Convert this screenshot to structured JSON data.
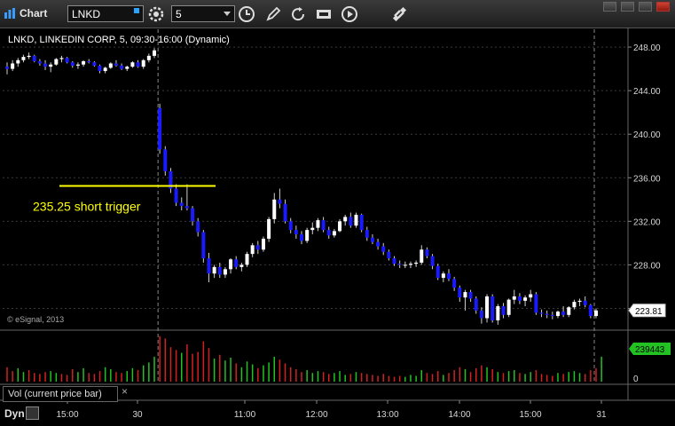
{
  "window": {
    "title": "Chart",
    "symbol_value": "LNKD",
    "interval_value": "5"
  },
  "icons": [
    "chart-icon",
    "settings-icon",
    "clock-icon",
    "pencil-icon",
    "refresh-icon",
    "go-icon",
    "play-icon",
    "link-icon",
    "minimize-icon",
    "maximize-icon",
    "close-icon"
  ],
  "chart_header": "LNKD, LINKEDIN CORP, 5, 09:30-16:00 (Dynamic)",
  "copyright": "© eSignal, 2013",
  "volume_panel_label": "Vol (current price bar)",
  "volume_close_glyph": "×",
  "dyn_label": "Dyn",
  "chart_data": {
    "type": "candlestick",
    "y_ticks": [
      "248.00",
      "244.00",
      "240.00",
      "236.00",
      "232.00",
      "228.00",
      "224.00"
    ],
    "ylim": [
      222.0,
      249.8
    ],
    "x_ticks": [
      "15:00",
      "30",
      "11:00",
      "12:00",
      "13:00",
      "14:00",
      "15:00",
      "31"
    ],
    "last_price_label": "223.81",
    "volume_label": "239443",
    "volume_zero_label": "0",
    "annotation": {
      "text": "235.25 short trigger",
      "level": 235.25,
      "color": "#ffff00"
    },
    "colors": {
      "up": "#ffffff",
      "down": "#1a1aff",
      "vol_up": "#22c222",
      "vol_down": "#d42020",
      "grid": "#3a3a3a"
    },
    "candles": [
      [
        246.2,
        246.6,
        245.5,
        246.0
      ],
      [
        246.0,
        246.8,
        245.8,
        246.5
      ],
      [
        246.5,
        247.0,
        246.2,
        246.8
      ],
      [
        246.8,
        247.3,
        246.6,
        247.1
      ],
      [
        247.1,
        247.5,
        246.9,
        247.2
      ],
      [
        247.2,
        247.3,
        246.6,
        246.7
      ],
      [
        246.7,
        246.9,
        246.3,
        246.5
      ],
      [
        246.5,
        246.8,
        245.9,
        246.2
      ],
      [
        246.2,
        246.6,
        245.7,
        246.4
      ],
      [
        246.4,
        247.0,
        246.3,
        246.9
      ],
      [
        246.9,
        247.2,
        246.6,
        247.0
      ],
      [
        247.0,
        247.1,
        246.5,
        246.6
      ],
      [
        246.6,
        246.7,
        246.1,
        246.3
      ],
      [
        246.3,
        246.6,
        246.0,
        246.4
      ],
      [
        246.4,
        246.8,
        246.2,
        246.7
      ],
      [
        246.7,
        246.9,
        246.5,
        246.6
      ],
      [
        246.6,
        246.7,
        246.2,
        246.3
      ],
      [
        246.3,
        246.4,
        245.6,
        245.8
      ],
      [
        245.8,
        246.2,
        245.6,
        246.1
      ],
      [
        246.1,
        246.6,
        246.0,
        246.5
      ],
      [
        246.5,
        246.8,
        246.2,
        246.3
      ],
      [
        246.3,
        246.5,
        245.9,
        246.0
      ],
      [
        246.0,
        246.3,
        245.8,
        246.2
      ],
      [
        246.2,
        246.7,
        246.1,
        246.6
      ],
      [
        246.6,
        246.8,
        246.1,
        246.2
      ],
      [
        246.2,
        246.9,
        246.0,
        246.8
      ],
      [
        246.8,
        247.4,
        246.6,
        247.2
      ],
      [
        247.2,
        247.9,
        247.0,
        247.7
      ],
      [
        242.4,
        242.8,
        238.2,
        238.6
      ],
      [
        238.6,
        238.9,
        236.2,
        236.6
      ],
      [
        236.6,
        236.9,
        234.6,
        235.0
      ],
      [
        235.0,
        235.4,
        233.4,
        233.7
      ],
      [
        233.7,
        234.2,
        233.0,
        233.4
      ],
      [
        233.4,
        235.4,
        233.0,
        233.2
      ],
      [
        233.2,
        233.4,
        231.6,
        232.0
      ],
      [
        232.0,
        232.3,
        230.6,
        231.0
      ],
      [
        231.0,
        231.2,
        228.2,
        228.6
      ],
      [
        228.6,
        229.1,
        226.4,
        227.2
      ],
      [
        227.2,
        228.0,
        226.8,
        227.8
      ],
      [
        227.8,
        228.2,
        226.8,
        227.1
      ],
      [
        227.1,
        227.8,
        226.8,
        227.6
      ],
      [
        227.6,
        228.6,
        227.2,
        228.5
      ],
      [
        228.5,
        228.8,
        227.6,
        227.8
      ],
      [
        227.8,
        228.2,
        227.4,
        228.0
      ],
      [
        228.0,
        229.2,
        227.8,
        229.0
      ],
      [
        229.0,
        230.0,
        228.7,
        229.8
      ],
      [
        229.8,
        230.2,
        229.0,
        229.4
      ],
      [
        229.4,
        230.6,
        229.2,
        230.4
      ],
      [
        230.4,
        232.4,
        230.1,
        232.2
      ],
      [
        232.2,
        234.6,
        231.8,
        234.0
      ],
      [
        234.0,
        235.0,
        233.2,
        233.6
      ],
      [
        233.6,
        234.0,
        231.8,
        232.0
      ],
      [
        232.0,
        232.3,
        230.9,
        231.2
      ],
      [
        231.2,
        231.6,
        230.4,
        230.8
      ],
      [
        230.8,
        231.1,
        229.9,
        230.2
      ],
      [
        230.2,
        231.4,
        230.0,
        231.2
      ],
      [
        231.2,
        231.9,
        230.8,
        231.4
      ],
      [
        231.4,
        232.3,
        231.1,
        232.1
      ],
      [
        232.1,
        232.4,
        231.0,
        231.2
      ],
      [
        231.2,
        231.5,
        230.4,
        230.7
      ],
      [
        230.7,
        231.3,
        230.5,
        231.1
      ],
      [
        231.1,
        232.2,
        231.0,
        232.0
      ],
      [
        232.0,
        232.6,
        231.6,
        232.4
      ],
      [
        232.4,
        232.8,
        231.4,
        231.6
      ],
      [
        231.6,
        232.8,
        231.4,
        232.6
      ],
      [
        232.6,
        232.7,
        231.0,
        231.2
      ],
      [
        231.2,
        231.5,
        230.2,
        230.5
      ],
      [
        230.5,
        230.8,
        229.9,
        230.1
      ],
      [
        230.1,
        230.4,
        229.4,
        229.7
      ],
      [
        229.7,
        230.0,
        228.9,
        229.2
      ],
      [
        229.2,
        229.4,
        228.4,
        228.6
      ],
      [
        228.6,
        228.8,
        227.9,
        228.1
      ],
      [
        228.1,
        228.4,
        227.7,
        228.0
      ],
      [
        228.0,
        228.3,
        227.7,
        228.0
      ],
      [
        228.0,
        228.3,
        227.7,
        228.1
      ],
      [
        228.1,
        228.4,
        227.8,
        228.2
      ],
      [
        228.2,
        229.8,
        228.0,
        229.4
      ],
      [
        229.4,
        229.6,
        228.6,
        228.8
      ],
      [
        228.8,
        229.0,
        227.6,
        227.9
      ],
      [
        227.9,
        228.1,
        226.6,
        226.8
      ],
      [
        226.8,
        227.4,
        226.4,
        227.2
      ],
      [
        227.2,
        227.6,
        226.5,
        226.7
      ],
      [
        226.7,
        226.9,
        225.6,
        225.9
      ],
      [
        225.9,
        226.1,
        224.6,
        225.0
      ],
      [
        225.0,
        225.7,
        223.8,
        225.5
      ],
      [
        225.5,
        225.7,
        224.6,
        224.9
      ],
      [
        224.9,
        225.1,
        223.5,
        223.8
      ],
      [
        223.8,
        224.1,
        222.6,
        223.1
      ],
      [
        223.1,
        225.3,
        222.7,
        225.1
      ],
      [
        225.1,
        225.3,
        222.7,
        222.9
      ],
      [
        222.9,
        224.4,
        222.5,
        224.2
      ],
      [
        224.2,
        224.5,
        223.1,
        223.4
      ],
      [
        223.4,
        224.9,
        223.2,
        224.8
      ],
      [
        224.8,
        225.7,
        224.4,
        225.1
      ],
      [
        225.1,
        225.4,
        224.4,
        224.7
      ],
      [
        224.7,
        225.2,
        224.2,
        225.0
      ],
      [
        225.0,
        225.7,
        224.6,
        225.3
      ],
      [
        225.3,
        225.5,
        223.4,
        223.6
      ],
      [
        223.6,
        223.9,
        223.2,
        223.5
      ],
      [
        223.5,
        223.8,
        223.1,
        223.4
      ],
      [
        223.4,
        223.7,
        223.0,
        223.3
      ],
      [
        223.3,
        223.8,
        223.1,
        223.7
      ],
      [
        223.7,
        224.2,
        223.2,
        223.4
      ],
      [
        223.4,
        224.2,
        223.2,
        224.1
      ],
      [
        224.1,
        224.8,
        223.9,
        224.6
      ],
      [
        224.6,
        224.9,
        224.2,
        224.7
      ],
      [
        224.7,
        225.1,
        224.1,
        224.3
      ],
      [
        224.3,
        224.4,
        223.1,
        223.3
      ],
      [
        223.3,
        224.0,
        223.1,
        223.81
      ]
    ],
    "volumes": [
      [
        0.3,
        0
      ],
      [
        0.22,
        0
      ],
      [
        0.28,
        1
      ],
      [
        0.2,
        1
      ],
      [
        0.24,
        0
      ],
      [
        0.18,
        0
      ],
      [
        0.16,
        0
      ],
      [
        0.2,
        0
      ],
      [
        0.22,
        1
      ],
      [
        0.18,
        1
      ],
      [
        0.16,
        0
      ],
      [
        0.14,
        0
      ],
      [
        0.26,
        0
      ],
      [
        0.2,
        1
      ],
      [
        0.28,
        1
      ],
      [
        0.18,
        0
      ],
      [
        0.16,
        0
      ],
      [
        0.22,
        0
      ],
      [
        0.3,
        1
      ],
      [
        0.26,
        1
      ],
      [
        0.2,
        0
      ],
      [
        0.18,
        0
      ],
      [
        0.22,
        1
      ],
      [
        0.28,
        1
      ],
      [
        0.24,
        0
      ],
      [
        0.34,
        1
      ],
      [
        0.4,
        1
      ],
      [
        0.52,
        1
      ],
      [
        0.95,
        0
      ],
      [
        0.9,
        0
      ],
      [
        0.72,
        0
      ],
      [
        0.66,
        0
      ],
      [
        0.6,
        1
      ],
      [
        0.78,
        0
      ],
      [
        0.58,
        0
      ],
      [
        0.62,
        0
      ],
      [
        0.84,
        0
      ],
      [
        0.7,
        0
      ],
      [
        0.48,
        1
      ],
      [
        0.56,
        0
      ],
      [
        0.44,
        1
      ],
      [
        0.5,
        1
      ],
      [
        0.38,
        0
      ],
      [
        0.3,
        1
      ],
      [
        0.42,
        1
      ],
      [
        0.36,
        1
      ],
      [
        0.28,
        0
      ],
      [
        0.34,
        1
      ],
      [
        0.4,
        1
      ],
      [
        0.52,
        1
      ],
      [
        0.46,
        0
      ],
      [
        0.38,
        0
      ],
      [
        0.3,
        0
      ],
      [
        0.26,
        0
      ],
      [
        0.2,
        0
      ],
      [
        0.24,
        1
      ],
      [
        0.18,
        1
      ],
      [
        0.22,
        1
      ],
      [
        0.2,
        0
      ],
      [
        0.16,
        0
      ],
      [
        0.18,
        1
      ],
      [
        0.22,
        1
      ],
      [
        0.14,
        1
      ],
      [
        0.16,
        0
      ],
      [
        0.2,
        1
      ],
      [
        0.18,
        0
      ],
      [
        0.16,
        0
      ],
      [
        0.14,
        0
      ],
      [
        0.12,
        0
      ],
      [
        0.16,
        0
      ],
      [
        0.12,
        0
      ],
      [
        0.1,
        0
      ],
      [
        0.12,
        0
      ],
      [
        0.1,
        1
      ],
      [
        0.14,
        1
      ],
      [
        0.12,
        1
      ],
      [
        0.24,
        1
      ],
      [
        0.18,
        0
      ],
      [
        0.16,
        0
      ],
      [
        0.22,
        0
      ],
      [
        0.14,
        1
      ],
      [
        0.18,
        0
      ],
      [
        0.24,
        0
      ],
      [
        0.3,
        0
      ],
      [
        0.26,
        1
      ],
      [
        0.2,
        0
      ],
      [
        0.28,
        0
      ],
      [
        0.34,
        0
      ],
      [
        0.3,
        1
      ],
      [
        0.26,
        0
      ],
      [
        0.2,
        1
      ],
      [
        0.18,
        0
      ],
      [
        0.22,
        1
      ],
      [
        0.24,
        1
      ],
      [
        0.18,
        0
      ],
      [
        0.16,
        1
      ],
      [
        0.2,
        1
      ],
      [
        0.24,
        0
      ],
      [
        0.16,
        0
      ],
      [
        0.14,
        0
      ],
      [
        0.12,
        0
      ],
      [
        0.18,
        1
      ],
      [
        0.16,
        0
      ],
      [
        0.2,
        1
      ],
      [
        0.22,
        1
      ],
      [
        0.18,
        1
      ],
      [
        0.16,
        0
      ],
      [
        0.24,
        0
      ],
      [
        0.28,
        0
      ],
      [
        0.52,
        1
      ]
    ]
  }
}
